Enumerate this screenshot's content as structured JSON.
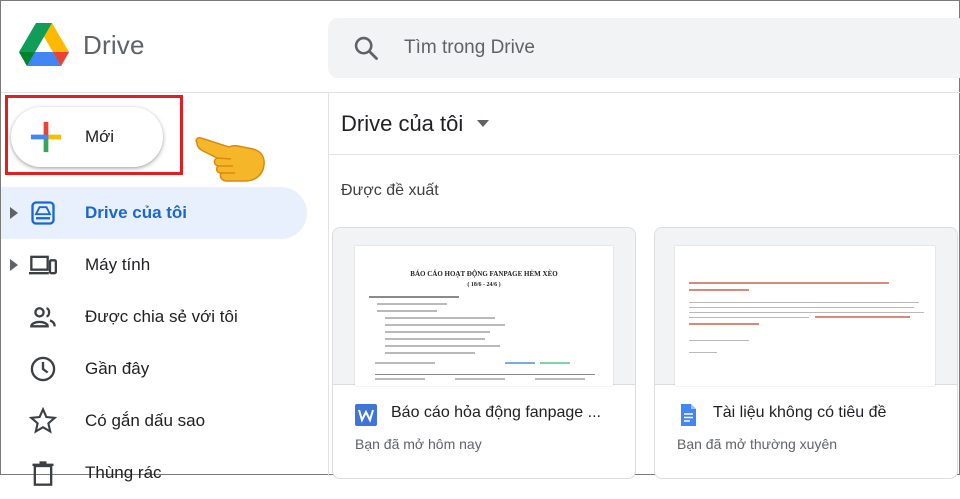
{
  "app": {
    "name": "Drive"
  },
  "search": {
    "placeholder": "Tìm trong Drive"
  },
  "new_button": {
    "label": "Mới"
  },
  "nav": {
    "items": [
      {
        "label": "Drive của tôi",
        "icon": "my-drive-icon",
        "active": true
      },
      {
        "label": "Máy tính",
        "icon": "computer-icon",
        "active": false
      },
      {
        "label": "Được chia sẻ với tôi",
        "icon": "shared-icon",
        "active": false
      },
      {
        "label": "Gần đây",
        "icon": "clock-icon",
        "active": false
      },
      {
        "label": "Có gắn dấu sao",
        "icon": "star-icon",
        "active": false
      },
      {
        "label": "Thùng rác",
        "icon": "trash-icon",
        "active": false
      }
    ]
  },
  "main": {
    "title": "Drive của tôi",
    "section": "Được đề xuất",
    "cards": [
      {
        "title": "Báo cáo hỏa động fanpage ...",
        "subtitle": "Bạn đã mở hôm nay",
        "file_icon": "word-icon",
        "preview_title": "BÁO CÁO HOẠT ĐỘNG FANPAGE HẺM XÈO",
        "preview_subtitle": "( 18/6 - 24/6 )"
      },
      {
        "title": "Tài liệu không có tiêu đề",
        "subtitle": "Bạn đã mở thường xuyên",
        "file_icon": "google-docs-icon"
      }
    ]
  },
  "colors": {
    "accent": "#1967d2",
    "active_bg": "#e8f0fe",
    "highlight": "#e02020"
  }
}
